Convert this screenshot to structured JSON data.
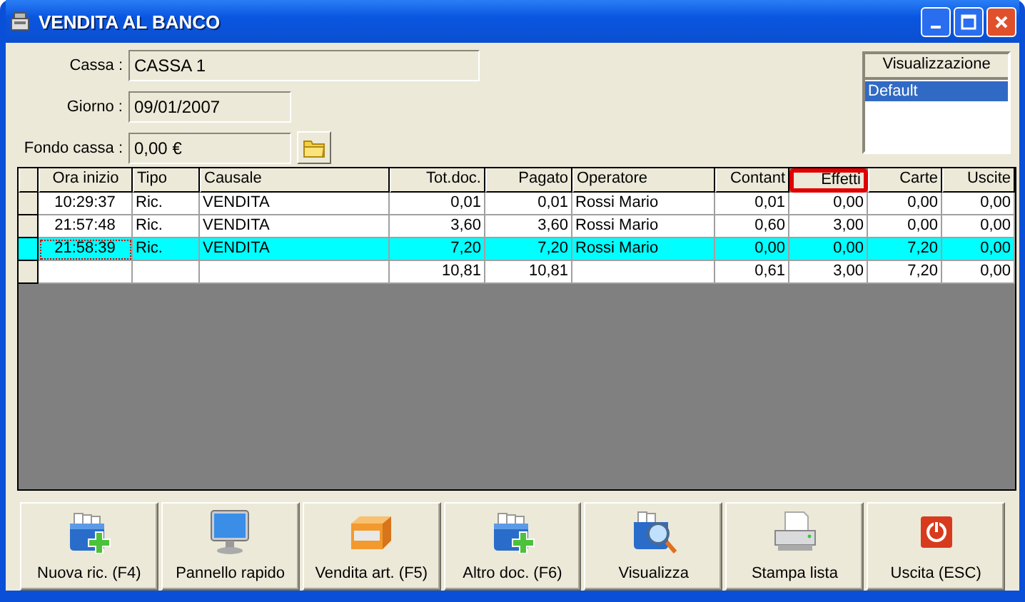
{
  "window": {
    "title": "VENDITA AL BANCO"
  },
  "fields": [
    {
      "label": "Cassa :",
      "value": "CASSA 1",
      "kind": "wide"
    },
    {
      "label": "Giorno :",
      "value": "09/01/2007",
      "kind": "short"
    },
    {
      "label": "Fondo cassa :",
      "value": "0,00 €",
      "kind": "folder"
    }
  ],
  "view_list": {
    "header": "Visualizzazione",
    "items": [
      {
        "label": "Default",
        "selected": true
      }
    ]
  },
  "grid": {
    "columns": [
      {
        "label": "Ora inizio",
        "highlighted": false
      },
      {
        "label": "Tipo",
        "highlighted": false
      },
      {
        "label": "Causale",
        "highlighted": false
      },
      {
        "label": "Tot.doc.",
        "highlighted": false
      },
      {
        "label": "Pagato",
        "highlighted": false
      },
      {
        "label": "Operatore",
        "highlighted": false
      },
      {
        "label": "Contant",
        "highlighted": false
      },
      {
        "label": "Effetti",
        "highlighted": true
      },
      {
        "label": "Carte",
        "highlighted": false
      },
      {
        "label": "Uscite",
        "highlighted": false
      }
    ],
    "rows": [
      {
        "selected": false,
        "cells": [
          "10:29:37",
          "Ric.",
          "VENDITA",
          "0,01",
          "0,01",
          "Rossi Mario",
          "0,01",
          "0,00",
          "0,00",
          "0,00"
        ]
      },
      {
        "selected": false,
        "cells": [
          "21:57:48",
          "Ric.",
          "VENDITA",
          "3,60",
          "3,60",
          "Rossi Mario",
          "0,60",
          "3,00",
          "0,00",
          "0,00"
        ]
      },
      {
        "selected": true,
        "cells": [
          "21:58:39",
          "Ric.",
          "VENDITA",
          "7,20",
          "7,20",
          "Rossi Mario",
          "0,00",
          "0,00",
          "7,20",
          "0,00"
        ]
      },
      {
        "selected": false,
        "cells": [
          "",
          "",
          "",
          "10,81",
          "10,81",
          "",
          "0,61",
          "3,00",
          "7,20",
          "0,00"
        ]
      }
    ]
  },
  "buttons": [
    {
      "label": "Nuova ric. (F4)"
    },
    {
      "label": "Pannello rapido"
    },
    {
      "label": "Vendita art. (F5)"
    },
    {
      "label": "Altro doc. (F6)"
    },
    {
      "label": "Visualizza"
    },
    {
      "label": "Stampa lista"
    },
    {
      "label": "Uscita (ESC)"
    }
  ]
}
